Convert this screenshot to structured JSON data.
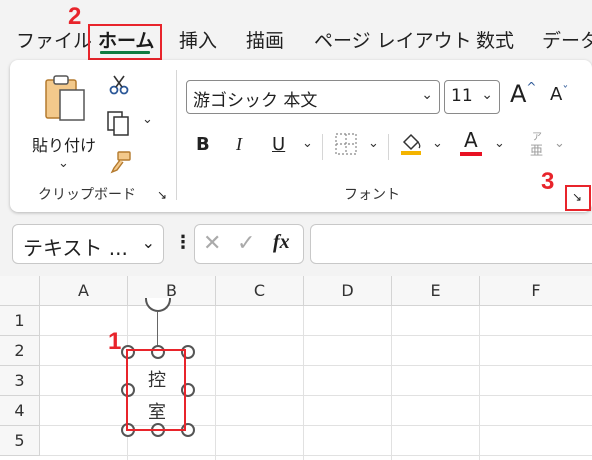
{
  "menu": {
    "tabs": [
      "ファイル",
      "ホーム",
      "挿入",
      "描画",
      "ページ レイアウト",
      "数式",
      "データ"
    ]
  },
  "callouts": {
    "one": "1",
    "two": "2",
    "three": "3"
  },
  "clipboard": {
    "paste_label": "貼り付け",
    "group_label": "クリップボード"
  },
  "font": {
    "family": "游ゴシック 本文",
    "size": "11",
    "group_label": "フォント",
    "bold": "B",
    "italic": "I",
    "underline": "U",
    "grow": "A",
    "shrink": "A",
    "font_color": "A",
    "phonetic_top": "ア",
    "phonetic_bottom": "亜"
  },
  "formula_bar": {
    "name_box": "テキスト ...",
    "fx": "fx"
  },
  "grid": {
    "columns": [
      "A",
      "B",
      "C",
      "D",
      "E",
      "F"
    ],
    "rows": [
      "1",
      "2",
      "3",
      "4",
      "5"
    ]
  },
  "textbox": {
    "line1": "控",
    "line2": "室"
  },
  "colors": {
    "accent": "#107c41",
    "callout": "#e8242b",
    "highlight": "#f4b400",
    "font_color": "#e81123"
  }
}
